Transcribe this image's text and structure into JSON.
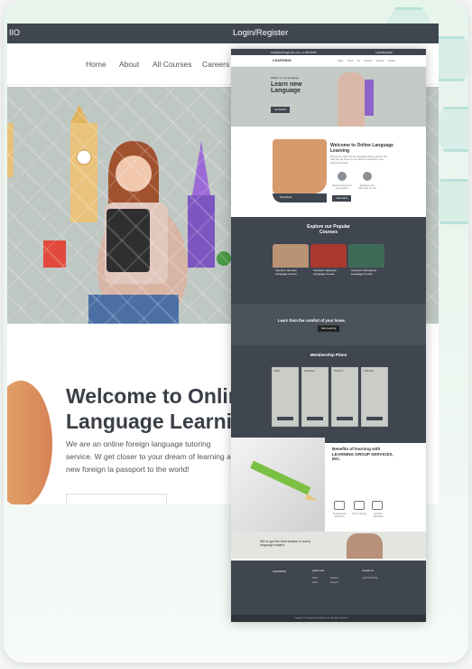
{
  "back": {
    "brand": "IIO",
    "login": "Login/Register",
    "nav": [
      "Home",
      "About",
      "All Courses",
      "Careers"
    ],
    "welcome_title": "Welcome to Onlin\nLanguage Learni",
    "welcome_desc": "We are an online foreign language tutoring service. W get closer to your dream of learning a new foreign la passport to the world!"
  },
  "front": {
    "top_left": "info@learninggroup.com   +1 234 5678",
    "top_right": "Login/Register",
    "logo": "LEARNING",
    "nav": "Home  About  All Courses  Careers  Contact",
    "hero_small": "Master a new language",
    "hero_title": "Learn new Language",
    "hero_btn": "Get Started",
    "welcome_title": "Welcome to Online Language Learning",
    "welcome_desc": "We are an online foreign language tutoring service. We help you get closer to your dream of learning a new foreign language.",
    "enroll": "Enroll Now!",
    "feature1": "Best learning from live experts",
    "feature2": "Enhance your skills with us now",
    "learn_more": "Learn More",
    "courses_title": "Explore our Popular Courses",
    "courses": [
      "Intensive German Language Course",
      "Intensive Japanese Language Course",
      "Intensive Portuguese Language Course"
    ],
    "comfort": "Learn from the comfort of your home.",
    "comfort_btn": "Start Learning",
    "membership_title": "Membership Plans",
    "plans": [
      "Basic",
      "Advanced",
      "Premium",
      "Unlimited"
    ],
    "benefits_title": "Benefits of learning with LEARNING GROUP SERVICES, INC.",
    "benefits": [
      "Professional Teachers",
      "24/7 Learning",
      "Flexible Schedule"
    ],
    "teacher": "We've got the best teacher in every language subject",
    "footer_headings": [
      "Quick Links",
      "Contact Us"
    ],
    "footer_links": [
      "Home",
      "About",
      "Courses",
      "Careers",
      "Contact"
    ],
    "footer_contact": "1234 5678 9012",
    "copyright": "Copyright © Learning Group Services Inc. All rights reserved."
  }
}
